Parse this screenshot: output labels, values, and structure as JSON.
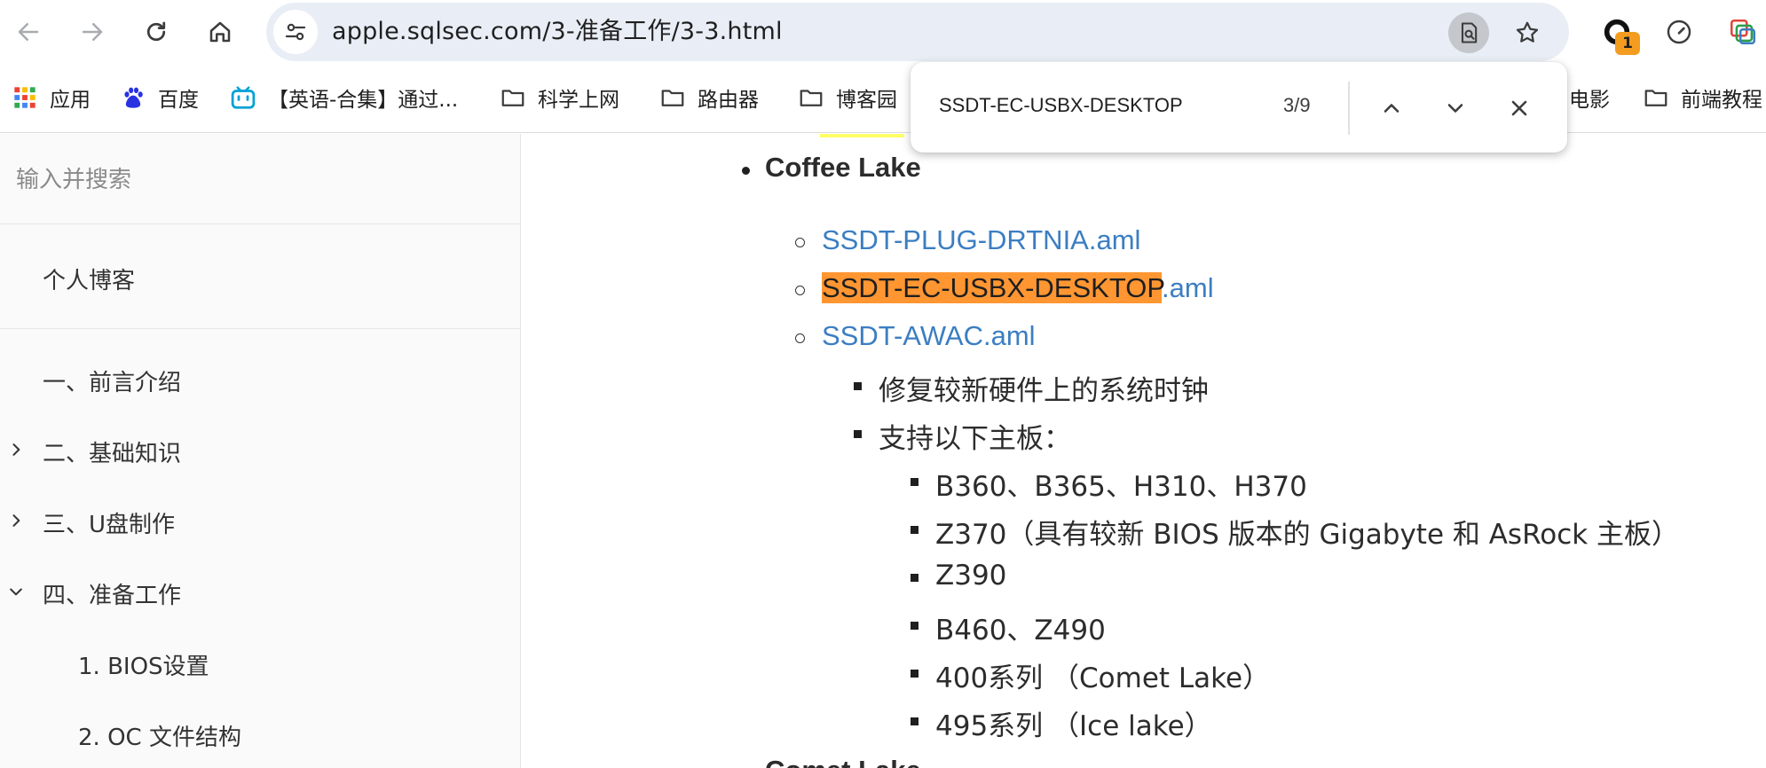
{
  "browser": {
    "url": "apple.sqlsec.com/3-准备工作/3-3.html",
    "extension_badge": "1",
    "nav": {
      "back_icon": "arrow-left-icon",
      "forward_icon": "arrow-right-icon",
      "reload_icon": "reload-icon",
      "home_icon": "home-icon"
    }
  },
  "bookmarks": [
    {
      "label": "应用",
      "icon": "apps-grid-icon"
    },
    {
      "label": "百度",
      "icon": "baidu-paw-icon"
    },
    {
      "label": "【英语-合集】通过...",
      "icon": "bilibili-icon"
    },
    {
      "label": "科学上网",
      "icon": "folder-icon"
    },
    {
      "label": "路由器",
      "icon": "folder-icon"
    },
    {
      "label": "博客园",
      "icon": "folder-icon"
    },
    {
      "label": "电影",
      "icon": "folder-icon"
    },
    {
      "label": "前端教程",
      "icon": "folder-icon"
    }
  ],
  "findbar": {
    "query": "SSDT-EC-USBX-DESKTOP",
    "count": "3/9"
  },
  "sidebar": {
    "search_placeholder": "输入并搜索",
    "blog_link": "个人博客",
    "chapters": [
      {
        "label": "一、前言介绍"
      },
      {
        "label": "二、基础知识"
      },
      {
        "label": "三、U盘制作"
      },
      {
        "label": "四、准备工作"
      },
      {
        "label": "1. BIOS设置"
      },
      {
        "label": "2. OC 文件结构"
      }
    ]
  },
  "content": {
    "heading_item": "Coffee Lake",
    "links": [
      {
        "text": "SSDT-PLUG-DRTNIA.aml"
      },
      {
        "match": "SSDT-EC-USBX-DESKTOP",
        "rest": ".aml"
      },
      {
        "text": "SSDT-AWAC.aml"
      }
    ],
    "sub_items": [
      "修复较新硬件上的系统时钟",
      "支持以下主板："
    ],
    "boards": [
      "B360、B365、H310、H370",
      "Z370（具有较新 BIOS 版本的 Gigabyte 和 AsRock 主板）",
      "Z390",
      "B460、Z490",
      "400系列 （Comet Lake）",
      "495系列 （Ice lake）"
    ],
    "next_heading_partial": "Comet Lake"
  }
}
